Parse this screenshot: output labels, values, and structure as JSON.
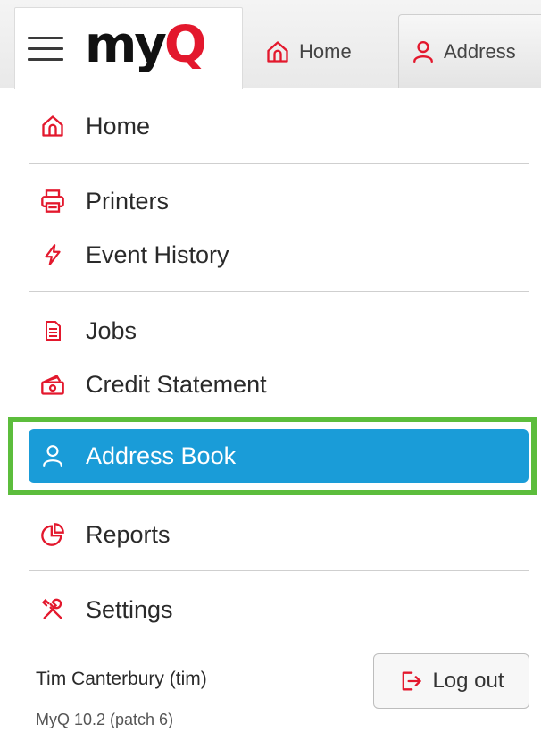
{
  "header": {
    "logo_text_main": "my",
    "logo_text_accent": "Q",
    "tabs": [
      {
        "label": "Home",
        "icon": "home-icon"
      },
      {
        "label": "Address",
        "icon": "user-icon"
      }
    ]
  },
  "menu": {
    "items": [
      {
        "label": "Home",
        "icon": "home-icon"
      },
      {
        "label": "Printers",
        "icon": "printer-icon"
      },
      {
        "label": "Event History",
        "icon": "lightning-icon"
      },
      {
        "label": "Jobs",
        "icon": "document-icon"
      },
      {
        "label": "Credit Statement",
        "icon": "cash-icon"
      },
      {
        "label": "Address Book",
        "icon": "user-icon"
      },
      {
        "label": "Reports",
        "icon": "pie-chart-icon"
      },
      {
        "label": "Settings",
        "icon": "tools-icon"
      }
    ],
    "active_item": "Address Book"
  },
  "footer": {
    "user": "Tim Canterbury (tim)",
    "version": "MyQ 10.2 (patch 6)",
    "logout_label": "Log out"
  },
  "colors": {
    "accent_red": "#e3182d",
    "active_blue": "#1a9cd8",
    "highlight_green": "#5cbd3c"
  }
}
